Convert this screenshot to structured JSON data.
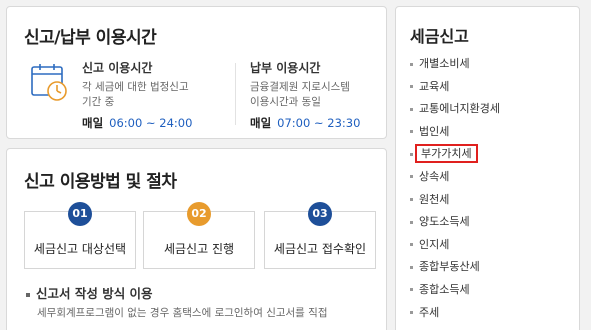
{
  "hours_card": {
    "title": "신고/납부 이용시간",
    "report": {
      "title": "신고 이용시간",
      "desc_line1": "각 세금에 대한 법정신고",
      "desc_line2": "기간 중",
      "day": "매일",
      "hours": "06:00 ~ 24:00"
    },
    "payment": {
      "title": "납부 이용시간",
      "desc_line1": "금융결제원 지로시스템",
      "desc_line2": "이용시간과 동일",
      "day": "매일",
      "hours": "07:00 ~ 23:30"
    },
    "icon": "clock-calendar-icon"
  },
  "procedure_card": {
    "title": "신고 이용방법 및 절차",
    "steps": [
      {
        "num": "01",
        "label": "세금신고 대상선택",
        "color": "#1e4f99"
      },
      {
        "num": "02",
        "label": "세금신고 진행",
        "color": "#e89b2d"
      },
      {
        "num": "03",
        "label": "세금신고 접수확인",
        "color": "#1e4f99"
      }
    ],
    "sub_title": "신고서 작성 방식 이용",
    "sub_desc": "세무회계프로그램이 없는 경우 홈택스에 로그인하여 신고서를 직접"
  },
  "tax_card": {
    "title": "세금신고",
    "items": [
      "개별소비세",
      "교육세",
      "교통에너지환경세",
      "법인세",
      "부가가치세",
      "상속세",
      "원천세",
      "양도소득세",
      "인지세",
      "종합부동산세",
      "종합소득세",
      "주세"
    ],
    "highlighted": "부가가치세",
    "highlight_color": "#e0201e"
  }
}
